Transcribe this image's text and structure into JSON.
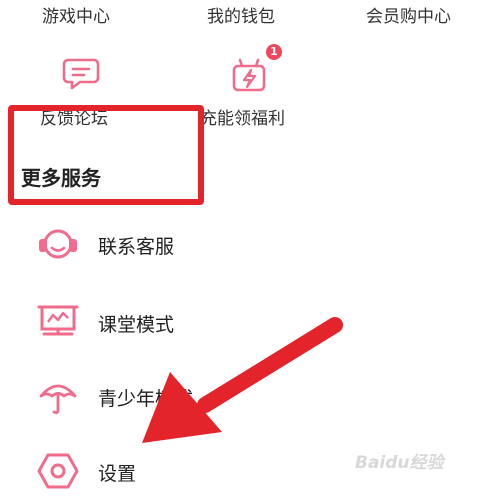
{
  "top_row": {
    "games": "游戏中心",
    "wallet": "我的钱包",
    "vip_shop": "会员购中心"
  },
  "grid": {
    "feedback_label": "反馈论坛",
    "charge_label": "充能领福利",
    "charge_badge": "1"
  },
  "section": {
    "title": "更多服务"
  },
  "services": [
    {
      "label": "联系客服",
      "icon": "headset-icon"
    },
    {
      "label": "课堂模式",
      "icon": "presentation-board-icon"
    },
    {
      "label": "青少年模式",
      "icon": "umbrella-icon"
    },
    {
      "label": "设置",
      "icon": "settings-hexagon-icon"
    }
  ],
  "watermark": "Baidu经验",
  "colors": {
    "accent_pink": "#f06b8c",
    "highlight_red": "#e3242b"
  }
}
